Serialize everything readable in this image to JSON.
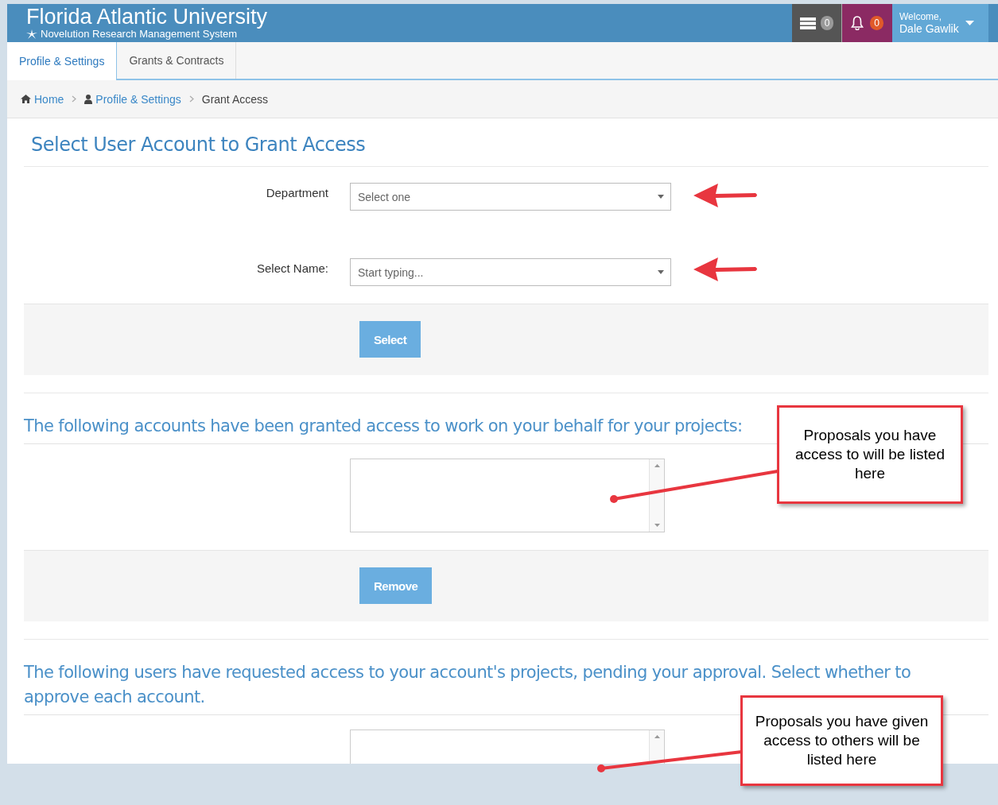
{
  "header": {
    "title": "Florida Atlantic University",
    "subtitle": "Novelution Research Management System",
    "messages_count": "0",
    "notifications_count": "0",
    "welcome": "Welcome,",
    "user_name": "Dale Gawlik"
  },
  "tabs": [
    {
      "label": "Profile & Settings",
      "selected": true
    },
    {
      "label": "Grants & Contracts",
      "selected": false
    }
  ],
  "breadcrumb": [
    {
      "label": "Home",
      "kind": "home",
      "current": false
    },
    {
      "label": "Profile & Settings",
      "kind": "user",
      "current": false
    },
    {
      "label": "Grant Access",
      "kind": "plain",
      "current": true
    }
  ],
  "page_title": "Select User Account to Grant Access",
  "form": {
    "fields": [
      {
        "label": "Department",
        "placeholder": "Select one"
      },
      {
        "label": "Select Name:",
        "placeholder": "Start typing..."
      }
    ],
    "button": "Select"
  },
  "granted": {
    "heading": "The following accounts have been granted access to work on your behalf for your projects:",
    "button": "Remove"
  },
  "requests": {
    "heading": "The following users have requested access to your account's projects, pending your approval. Select whether to approve each account."
  },
  "callouts": [
    {
      "text": "Proposals you have access to will be listed here"
    },
    {
      "text": "Proposals you have given access to others will be listed here"
    }
  ]
}
